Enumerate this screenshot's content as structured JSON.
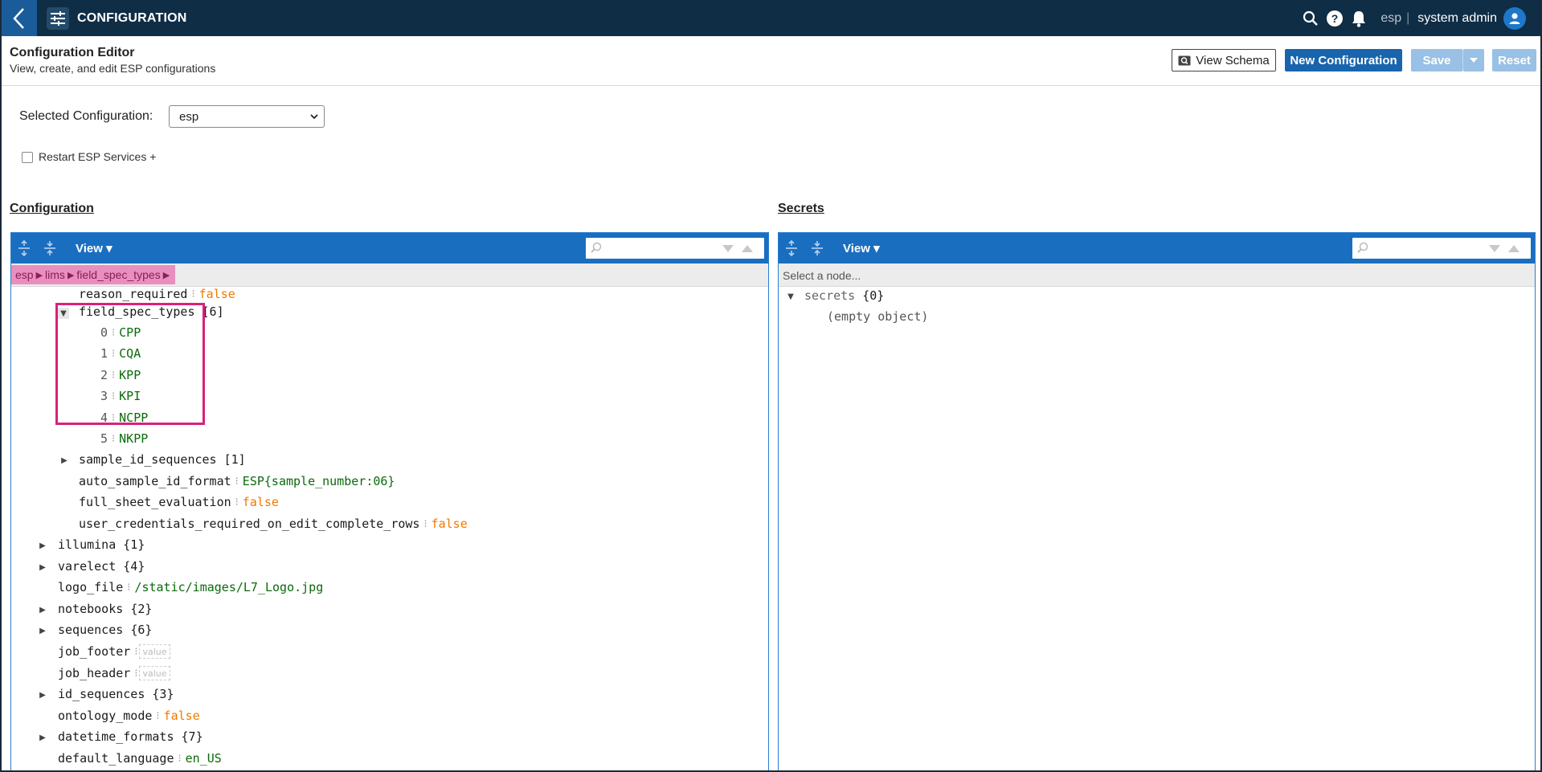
{
  "app": {
    "title": "CONFIGURATION"
  },
  "header": {
    "tenant": "esp",
    "tenant_sep": "|",
    "user": "system admin",
    "page_title": "Configuration Editor",
    "page_subtitle": "View, create, and edit ESP configurations",
    "view_schema_label": "View Schema",
    "new_configuration_label": "New Configuration",
    "save_label": "Save",
    "reset_label": "Reset"
  },
  "selection": {
    "label": "Selected Configuration:",
    "selected_value": "esp",
    "restart_label": "Restart ESP Services +",
    "restart_checked": false
  },
  "config_panel": {
    "title": "Configuration",
    "view_label": "View",
    "breadcrumb": [
      "esp",
      "lims",
      "field_spec_types"
    ],
    "rows": [
      {
        "key": "reason_required",
        "value": "false",
        "type": "bool"
      },
      {
        "key": "field_spec_types",
        "count": "[6]",
        "expanded": true
      },
      {
        "index": "0",
        "value": "CPP",
        "type": "str"
      },
      {
        "index": "1",
        "value": "CQA",
        "type": "str"
      },
      {
        "index": "2",
        "value": "KPP",
        "type": "str"
      },
      {
        "index": "3",
        "value": "KPI",
        "type": "str"
      },
      {
        "index": "4",
        "value": "NCPP",
        "type": "str"
      },
      {
        "index": "5",
        "value": "NKPP",
        "type": "str"
      },
      {
        "key": "sample_id_sequences",
        "count": "[1]"
      },
      {
        "key": "auto_sample_id_format",
        "value": "ESP{sample_number:06}",
        "type": "str"
      },
      {
        "key": "full_sheet_evaluation",
        "value": "false",
        "type": "bool"
      },
      {
        "key": "user_credentials_required_on_edit_complete_rows",
        "value": "false",
        "type": "bool"
      },
      {
        "key": "illumina",
        "count": "{1}"
      },
      {
        "key": "varelect",
        "count": "{4}"
      },
      {
        "key": "logo_file",
        "value": "/static/images/L7_Logo.jpg",
        "type": "str"
      },
      {
        "key": "notebooks",
        "count": "{2}"
      },
      {
        "key": "sequences",
        "count": "{6}"
      },
      {
        "key": "job_footer",
        "value": "value",
        "type": "empty"
      },
      {
        "key": "job_header",
        "value": "value",
        "type": "empty"
      },
      {
        "key": "id_sequences",
        "count": "{3}"
      },
      {
        "key": "ontology_mode",
        "value": "false",
        "type": "bool"
      },
      {
        "key": "datetime_formats",
        "count": "{7}"
      },
      {
        "key": "default_language",
        "value": "en_US",
        "type": "str"
      }
    ]
  },
  "secrets_panel": {
    "title": "Secrets",
    "view_label": "View",
    "select_node_text": "Select a node...",
    "root_key": "secrets",
    "root_count": "{0}",
    "empty_text": "(empty object)"
  },
  "colors": {
    "topbar": "#0f2d45",
    "toolbar": "#1a6ec0",
    "primary_button": "#1865ae",
    "highlight": "#d9217a",
    "string_value": "#0a6a0a",
    "bool_value": "#ef7a00"
  },
  "icons": [
    "back-chevron-icon",
    "sliders-icon",
    "search-icon",
    "help-icon",
    "bell-icon",
    "user-avatar-icon",
    "expand-all-icon",
    "collapse-all-icon",
    "search-next-icon",
    "search-prev-icon"
  ]
}
